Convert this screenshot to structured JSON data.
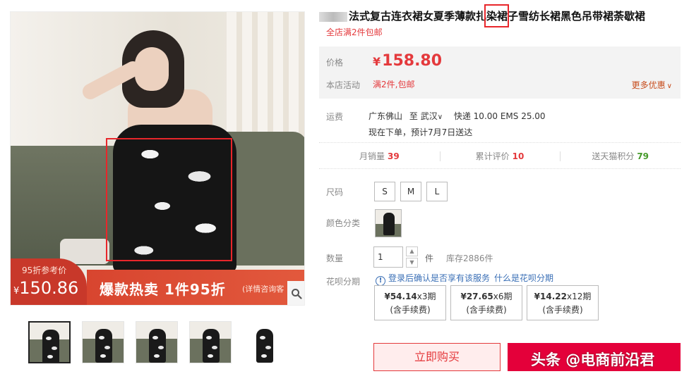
{
  "product": {
    "title": "法式复古连衣裙女夏季薄款扎染裙子雪纺长裙黑色吊带裙荼歇裙",
    "subtitle": "全店满2件包邮"
  },
  "promo": {
    "tag": "95折参考价",
    "price_symbol": "¥",
    "price": "150.86",
    "headline": "爆款热卖 1件95折",
    "subline": "(详情咨询客"
  },
  "price_box": {
    "price_label": "价格",
    "currency": "¥",
    "price": "158.80",
    "activity_label": "本店活动",
    "activity": "满2件,包邮",
    "more_label": "更多优惠"
  },
  "shipping": {
    "label": "运费",
    "from": "广东佛山",
    "to_word": "至",
    "to": "武汉",
    "express": "快递 10.00 EMS 25.00",
    "eta": "现在下单，预计7月7日送达"
  },
  "stats": [
    {
      "label": "月销量",
      "value": "39"
    },
    {
      "label": "累计评价",
      "value": "10"
    },
    {
      "label": "送天猫积分",
      "value": "79"
    }
  ],
  "size": {
    "label": "尺码",
    "options": [
      "S",
      "M",
      "L"
    ]
  },
  "color": {
    "label": "颜色分类"
  },
  "quantity": {
    "label": "数量",
    "value": "1",
    "unit": "件",
    "stock": "库存2886件"
  },
  "huabei": {
    "label": "花呗分期",
    "note": "登录后确认是否享有该服务",
    "link": "什么是花呗分期",
    "plans": [
      {
        "amount": "¥54.14",
        "periods": "x3期",
        "fee": "(含手续费)"
      },
      {
        "amount": "¥27.65",
        "periods": "x6期",
        "fee": "(含手续费)"
      },
      {
        "amount": "¥14.22",
        "periods": "x12期",
        "fee": "(含手续费)"
      }
    ]
  },
  "actions": {
    "buy_now": "立即购买"
  },
  "watermark": "头条 @电商前沿君",
  "colors": {
    "accent": "#e4393c",
    "cart_button": "#e4003a",
    "promo_band": "#d8452f",
    "link_blue": "#3a6fb6"
  }
}
